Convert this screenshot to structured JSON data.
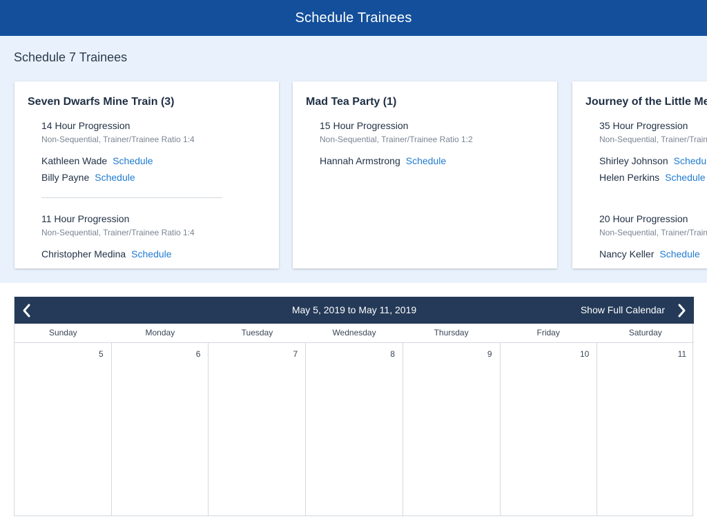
{
  "app": {
    "title": "Schedule Trainees"
  },
  "panel": {
    "heading": "Schedule 7 Trainees"
  },
  "cards": [
    {
      "title": "Seven Dwarfs Mine Train (3)",
      "progressions": [
        {
          "name": "14 Hour Progression",
          "meta": "Non-Sequential, Trainer/Trainee Ratio 1:4",
          "trainees": [
            {
              "name": "Kathleen Wade",
              "action": "Schedule"
            },
            {
              "name": "Billy Payne",
              "action": "Schedule"
            }
          ]
        },
        {
          "name": "11 Hour Progression",
          "meta": "Non-Sequential, Trainer/Trainee Ratio 1:4",
          "trainees": [
            {
              "name": "Christopher Medina",
              "action": "Schedule"
            }
          ]
        }
      ]
    },
    {
      "title": "Mad Tea Party (1)",
      "progressions": [
        {
          "name": "15 Hour Progression",
          "meta": "Non-Sequential, Trainer/Trainee Ratio 1:2",
          "trainees": [
            {
              "name": "Hannah Armstrong",
              "action": "Schedule"
            }
          ]
        }
      ]
    },
    {
      "title": "Journey of the Little Me",
      "progressions": [
        {
          "name": "35 Hour Progression",
          "meta": "Non-Sequential, Trainer/Train",
          "trainees": [
            {
              "name": "Shirley Johnson",
              "action": "Schedu"
            },
            {
              "name": "Helen Perkins",
              "action": "Schedule"
            }
          ]
        },
        {
          "name": "20 Hour Progression",
          "meta": "Non-Sequential, Trainer/Train",
          "trainees": [
            {
              "name": "Nancy Keller",
              "action": "Schedule"
            }
          ]
        }
      ]
    }
  ],
  "calendar": {
    "range": "May 5, 2019 to May 11, 2019",
    "full_calendar_label": "Show Full Calendar",
    "prev_icon": "chevron-left-icon",
    "next_icon": "chevron-right-icon",
    "weekdays": [
      "Sunday",
      "Monday",
      "Tuesday",
      "Wednesday",
      "Thursday",
      "Friday",
      "Saturday"
    ],
    "dates": [
      "5",
      "6",
      "7",
      "8",
      "9",
      "10",
      "11"
    ]
  },
  "colors": {
    "topbar": "#134f9b",
    "panel_bg": "#e9f2fc",
    "calendar_header": "#243a58",
    "link": "#1f7bd0"
  }
}
